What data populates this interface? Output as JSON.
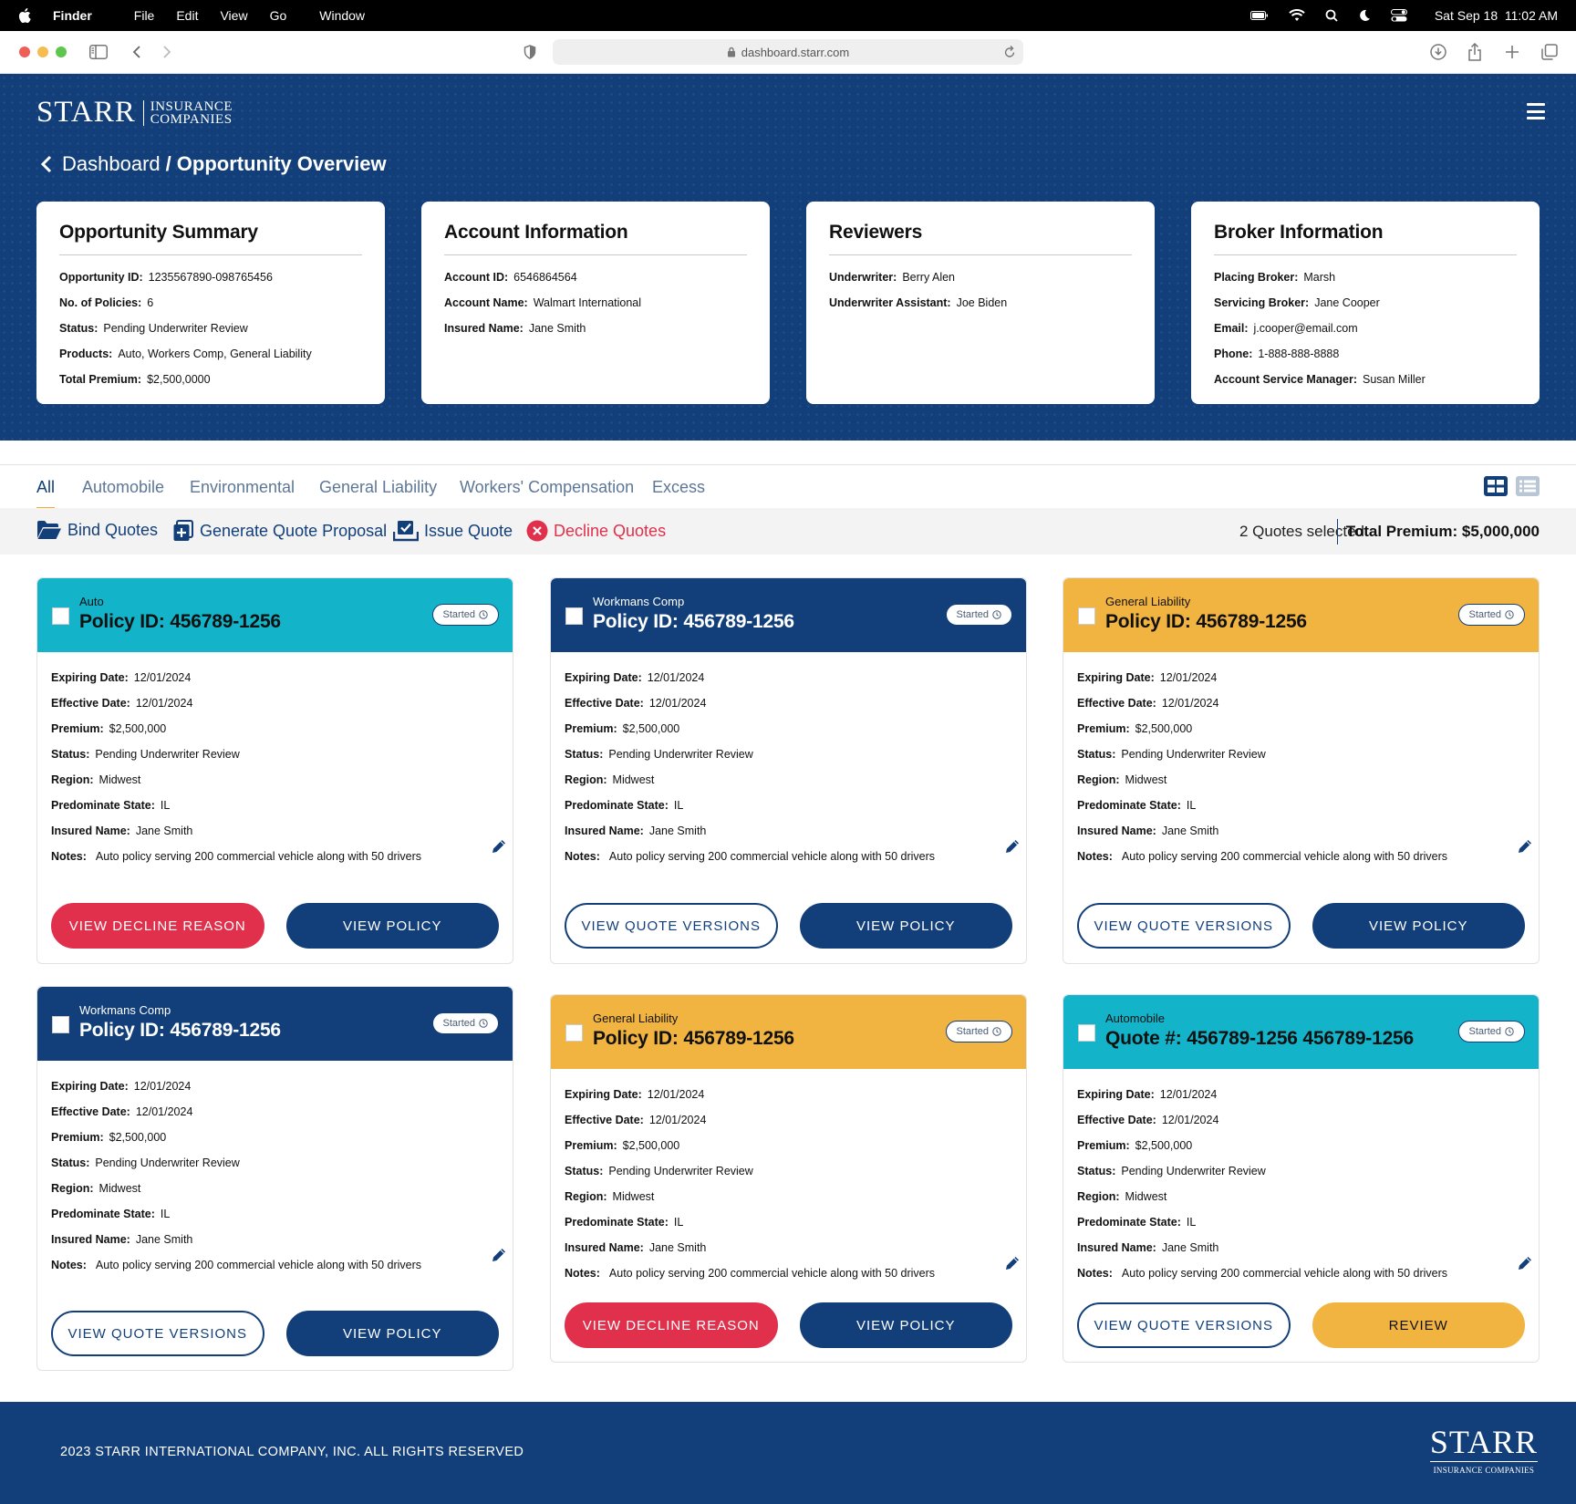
{
  "menubar": {
    "app": "Finder",
    "items": [
      "File",
      "Edit",
      "View",
      "Go",
      "Window"
    ],
    "datetime": "Sat Sep 18  11:02 AM"
  },
  "browser": {
    "url": "dashboard.starr.com"
  },
  "brand": {
    "name": "STARR",
    "sub_line1": "INSURANCE",
    "sub_line2": "COMPANIES",
    "navy": "#123f79",
    "gold": "#f2b441",
    "teal": "#13b3c9",
    "red": "#e0304c"
  },
  "breadcrumb": {
    "parent": "Dashboard",
    "separator": "/",
    "current": "Opportunity Overview"
  },
  "summary_cards": [
    {
      "title": "Opportunity Summary",
      "rows": [
        {
          "k": "Opportunity ID:",
          "v": "1235567890-098765456"
        },
        {
          "k": "No. of Policies:",
          "v": "6"
        },
        {
          "k": "Status:",
          "v": "Pending Underwriter Review"
        },
        {
          "k": "Products:",
          "v": "Auto, Workers Comp,  General Liability"
        },
        {
          "k": "Total Premium:",
          "v": "$2,500,0000"
        }
      ]
    },
    {
      "title": "Account Information",
      "rows": [
        {
          "k": "Account ID:",
          "v": "6546864564"
        },
        {
          "k": "Account Name:",
          "v": "Walmart International"
        },
        {
          "k": "Insured Name:",
          "v": "Jane Smith"
        }
      ]
    },
    {
      "title": "Reviewers",
      "rows": [
        {
          "k": "Underwriter:",
          "v": "Berry Alen"
        },
        {
          "k": "Underwriter Assistant:",
          "v": "Joe Biden"
        }
      ]
    },
    {
      "title": "Broker Information",
      "rows": [
        {
          "k": "Placing Broker:",
          "v": "Marsh"
        },
        {
          "k": "Servicing Broker:",
          "v": "Jane Cooper"
        },
        {
          "k": "Email:",
          "v": "j.cooper@email.com"
        },
        {
          "k": "Phone:",
          "v": "1-888-888-8888"
        },
        {
          "k": "Account Service Manager:",
          "v": "Susan Miller"
        }
      ]
    }
  ],
  "tabs": [
    "All",
    "Automobile",
    "Environmental",
    "General Liability",
    "Workers' Compensation",
    "Excess"
  ],
  "active_tab": "All",
  "actions": {
    "bind": "Bind Quotes",
    "proposal": "Generate Quote Proposal",
    "issue": "Issue Quote",
    "decline": "Decline Quotes",
    "selected": "2 Quotes selected",
    "total_premium": "Total Premium: $5,000,000"
  },
  "field_labels": {
    "expiring": "Expiring Date:",
    "effective": "Effective Date:",
    "premium": "Premium:",
    "status": "Status:",
    "region": "Region:",
    "state": "Predominate State:",
    "insured": "Insured Name:",
    "notes": "Notes:"
  },
  "policies": [
    {
      "category": "Auto",
      "header_color": "teal",
      "id_label": "Policy ID:  456789-1256",
      "badge": "Started",
      "expiring": "12/01/2024",
      "effective": "12/01/2024",
      "premium": "$2,500,000",
      "status": "Pending Underwriter Review",
      "region": "Midwest",
      "state": "IL",
      "insured": "Jane Smith",
      "notes": "Auto policy serving 200 commercial vehicle along with 50 drivers",
      "left_button": "VIEW DECLINE REASON",
      "left_style": "danger",
      "right_button": "VIEW POLICY",
      "right_style": "primary"
    },
    {
      "category": "Workmans Comp",
      "header_color": "navy",
      "id_label": "Policy ID:  456789-1256",
      "badge": "Started",
      "expiring": "12/01/2024",
      "effective": "12/01/2024",
      "premium": "$2,500,000",
      "status": "Pending Underwriter Review",
      "region": "Midwest",
      "state": "IL",
      "insured": "Jane Smith",
      "notes": "Auto policy serving 200 commercial vehicle along with 50 drivers",
      "left_button": "VIEW QUOTE VERSIONS",
      "left_style": "outline",
      "right_button": "VIEW POLICY",
      "right_style": "primary"
    },
    {
      "category": "General Liability",
      "header_color": "gold",
      "id_label": "Policy ID:  456789-1256",
      "badge": "Started",
      "expiring": "12/01/2024",
      "effective": "12/01/2024",
      "premium": "$2,500,000",
      "status": "Pending Underwriter Review",
      "region": "Midwest",
      "state": "IL",
      "insured": "Jane Smith",
      "notes": "Auto policy serving 200 commercial vehicle along with 50 drivers",
      "left_button": "VIEW QUOTE VERSIONS",
      "left_style": "outline",
      "right_button": "VIEW POLICY",
      "right_style": "primary"
    },
    {
      "category": "Workmans Comp",
      "header_color": "navy",
      "id_label": "Policy ID:  456789-1256",
      "badge": "Started",
      "expiring": "12/01/2024",
      "effective": "12/01/2024",
      "premium": "$2,500,000",
      "status": "Pending Underwriter Review",
      "region": "Midwest",
      "state": "IL",
      "insured": "Jane Smith",
      "notes": "Auto policy serving 200 commercial vehicle along with 50 drivers",
      "left_button": "VIEW QUOTE VERSIONS",
      "left_style": "outline",
      "right_button": "VIEW POLICY",
      "right_style": "primary"
    },
    {
      "category": "General Liability",
      "header_color": "gold",
      "id_label": "Policy ID:  456789-1256",
      "badge": "Started",
      "expiring": "12/01/2024",
      "effective": "12/01/2024",
      "premium": "$2,500,000",
      "status": "Pending Underwriter Review",
      "region": "Midwest",
      "state": "IL",
      "insured": "Jane Smith",
      "notes": "Auto policy serving 200 commercial vehicle along with 50 drivers",
      "left_button": "VIEW DECLINE REASON",
      "left_style": "danger",
      "right_button": "VIEW POLICY",
      "right_style": "primary"
    },
    {
      "category": "Automobile",
      "header_color": "teal",
      "id_label": "Quote #: 456789-1256  456789-1256",
      "badge": "Started",
      "expiring": "12/01/2024",
      "effective": "12/01/2024",
      "premium": "$2,500,000",
      "status": "Pending Underwriter Review",
      "region": "Midwest",
      "state": "IL",
      "insured": "Jane Smith",
      "notes": "Auto policy serving 200 commercial vehicle along with 50 drivers",
      "left_button": "VIEW QUOTE VERSIONS",
      "left_style": "outline",
      "right_button": "REVIEW",
      "right_style": "review"
    }
  ],
  "footer": {
    "copyright": "2023 STARR INTERNATIONAL COMPANY, INC. ALL RIGHTS RESERVED",
    "logo": "STARR",
    "logo_sub": "INSURANCE COMPANIES"
  }
}
